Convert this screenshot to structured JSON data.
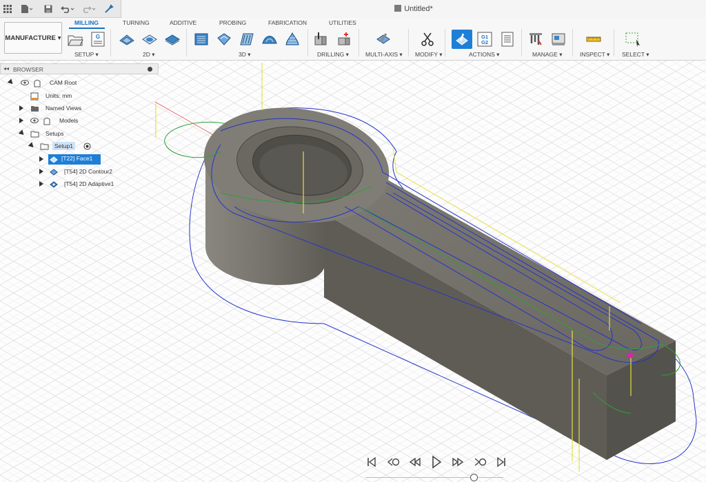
{
  "window": {
    "title": "Untitled*"
  },
  "quick_access": {
    "icons": [
      "app-grid-icon",
      "file-icon",
      "save-icon",
      "undo-icon",
      "redo-icon",
      "tool-icon"
    ]
  },
  "ribbon": {
    "workspace": "MANUFACTURE",
    "tabs": [
      "MILLING",
      "TURNING",
      "ADDITIVE",
      "PROBING",
      "FABRICATION",
      "UTILITIES"
    ],
    "active_tab": "MILLING",
    "groups": [
      "SETUP ▾",
      "2D ▾",
      "3D ▾",
      "DRILLING ▾",
      "MULTI-AXIS ▾",
      "MODIFY ▾",
      "ACTIONS ▾",
      "MANAGE ▾",
      "INSPECT ▾",
      "SELECT ▾"
    ],
    "g1g2_icon_text": [
      "G1",
      "G2"
    ],
    "setup_icon_text": "G"
  },
  "browser": {
    "title": "BROWSER",
    "nodes": [
      {
        "label": "CAM Root"
      },
      {
        "label": "Units: mm"
      },
      {
        "label": "Named Views"
      },
      {
        "label": "Models"
      },
      {
        "label": "Setups"
      },
      {
        "label": "Setup1"
      },
      {
        "label": "[T22] Face1"
      },
      {
        "label": "[T54] 2D Contour2"
      },
      {
        "label": "[T54] 2D Adaptive1"
      }
    ]
  },
  "colors": {
    "accent": "#1a6fc2",
    "selection": "#1e7fd6",
    "part": "#6e6b64",
    "toolpath_blue": "#1f2fbf",
    "toolpath_green": "#2fa03a",
    "toolpath_yellow": "#e6df40",
    "grid": "#e3e3e3"
  }
}
